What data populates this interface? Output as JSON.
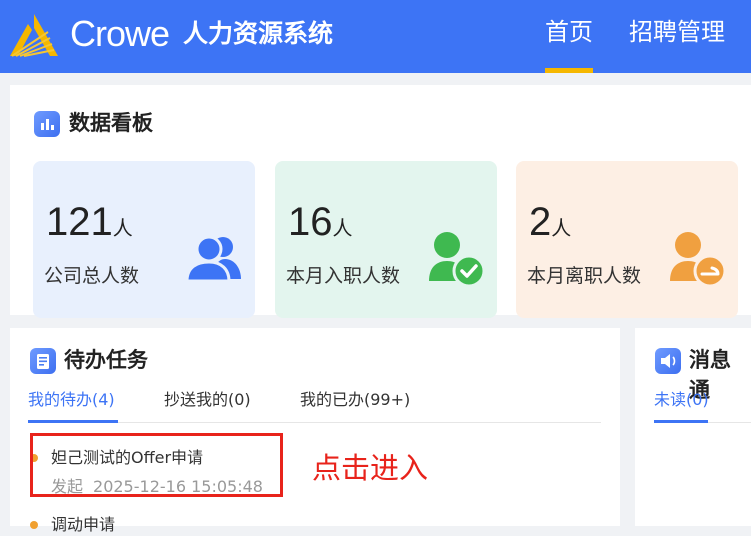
{
  "header": {
    "brand": "Crowe",
    "system_name": "人力资源系统",
    "nav": [
      {
        "label": "首页",
        "active": true
      },
      {
        "label": "招聘管理",
        "active": false
      }
    ],
    "bg_color": "#3d74f5",
    "accent_color": "#f5b700"
  },
  "dashboard": {
    "title": "数据看板",
    "icon": "bar-chart-icon",
    "cards": [
      {
        "value": "121",
        "unit": "人",
        "label": "公司总人数",
        "icon": "users-group-icon",
        "color": "#3d74f5"
      },
      {
        "value": "16",
        "unit": "人",
        "label": "本月入职人数",
        "icon": "user-check-icon",
        "color": "#3fb950"
      },
      {
        "value": "2",
        "unit": "人",
        "label": "本月离职人数",
        "icon": "user-leave-icon",
        "color": "#f0a040"
      }
    ]
  },
  "todo": {
    "title": "待办任务",
    "icon": "document-icon",
    "tabs": [
      {
        "label": "我的待办(4)",
        "active": true
      },
      {
        "label": "抄送我的(0)",
        "active": false
      },
      {
        "label": "我的已办(99+)",
        "active": false
      }
    ],
    "tasks": [
      {
        "title": "妲己测试的Offer申请",
        "status": "发起",
        "time": "2025-12-16 15:05:48"
      },
      {
        "title": "调动申请"
      }
    ],
    "annotation": "点击进入"
  },
  "messages": {
    "title": "消息通",
    "icon": "speaker-icon",
    "tabs": [
      {
        "label": "未读(0)",
        "active": true
      }
    ]
  }
}
